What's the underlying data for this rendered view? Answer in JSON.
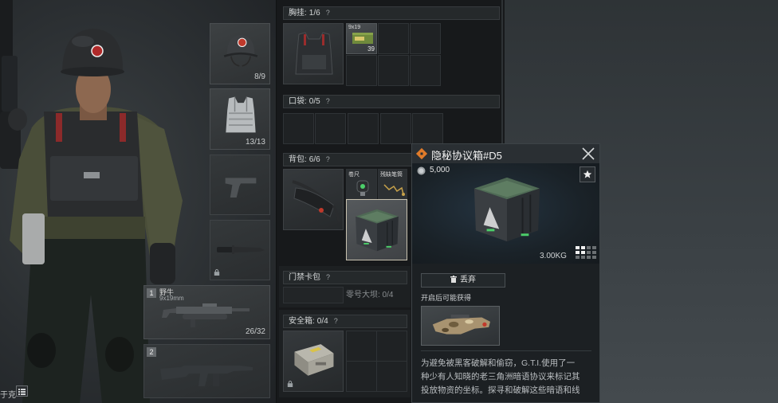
{
  "screen": {
    "bottom_left_label": "于克",
    "list_icon": "list-icon"
  },
  "equipment": {
    "helmet": {
      "icon": "helmet-icon",
      "durability": "8/9"
    },
    "armor": {
      "icon": "body-armor-icon",
      "durability": "13/13"
    },
    "pistol": {
      "icon": "pistol-silhouette-icon"
    },
    "melee": {
      "icon": "knife-icon",
      "locked": true
    }
  },
  "weapons": [
    {
      "slot": "1",
      "name": "野牛",
      "caliber": "9x19mm",
      "ammo": "26/32",
      "icon": "smg-icon"
    },
    {
      "slot": "2",
      "icon": "rifle-silhouette-icon"
    }
  ],
  "chest_rig": {
    "label": "胸挂:",
    "capacity": "1/6",
    "help": "?",
    "icon": "chest-rig-icon",
    "items": [
      {
        "name": "9x19",
        "count": "39",
        "icon": "ammo-box-icon"
      }
    ]
  },
  "pocket": {
    "label": "口袋:",
    "capacity": "0/5",
    "help": "?"
  },
  "backpack": {
    "label": "背包:",
    "capacity": "6/6",
    "help": "?",
    "icon": "waist-bag-icon",
    "items": [
      {
        "name": "卷尺",
        "icon": "tape-measure-icon"
      },
      {
        "name": "残缺笔筒",
        "icon": "chain-item-icon"
      },
      {
        "icon": "crate-icon",
        "selected": true
      }
    ]
  },
  "keycard": {
    "label": "门禁卡包",
    "help": "?",
    "entry": "零号大坝: 0/4"
  },
  "safe": {
    "label": "安全箱:",
    "capacity": "0/4",
    "help": "?",
    "icon": "safe-box-icon",
    "locked": true
  },
  "popup": {
    "title": "隐秘协议箱#D5",
    "price": "5,000",
    "weight": "3.00KG",
    "discard_label": "丢弃",
    "loot_label": "开启后可能获得",
    "description": [
      "为避免被黑客破解和偷窃，G.T.I.使用了一",
      "种少有人知晓的老三角洲暗语协议来标记其",
      "投放物资的坐标。探寻和破解这些暗语和线"
    ],
    "icons": {
      "title": "rarity-diamond-icon",
      "price": "coin-icon",
      "favorite": "star-icon",
      "close": "close-icon",
      "discard": "trash-icon",
      "size": "grid-size-icon",
      "loot": "smg-p90-icon"
    }
  },
  "colors": {
    "accent_orange": "#e07b2a",
    "selection_border": "#c8c2b0",
    "latch_green": "#4ccf6a",
    "emblem_red": "#c0392b"
  }
}
